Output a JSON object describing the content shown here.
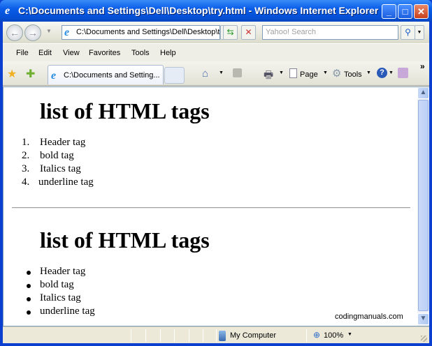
{
  "window": {
    "title": "C:\\Documents and Settings\\Dell\\Desktop\\try.html - Windows Internet Explorer"
  },
  "nav": {
    "address": "C:\\Documents and Settings\\Dell\\Desktop\\try.html",
    "search_placeholder": "Yahoo! Search"
  },
  "menu": [
    "File",
    "Edit",
    "View",
    "Favorites",
    "Tools",
    "Help"
  ],
  "tab": {
    "label": "C:\\Documents and Setting..."
  },
  "toolbar": {
    "page": "Page",
    "tools": "Tools",
    "more": "»"
  },
  "page": {
    "heading1": "list of HTML tags",
    "ordered": [
      "Header tag",
      "bold tag",
      "Italics tag",
      "underline tag"
    ],
    "heading2": "list of HTML tags",
    "unordered": [
      "Header tag",
      "bold tag",
      "Italics tag",
      "underline tag"
    ],
    "watermark": "codingmanuals.com"
  },
  "status": {
    "zone": "My Computer",
    "zoom": "100%"
  }
}
